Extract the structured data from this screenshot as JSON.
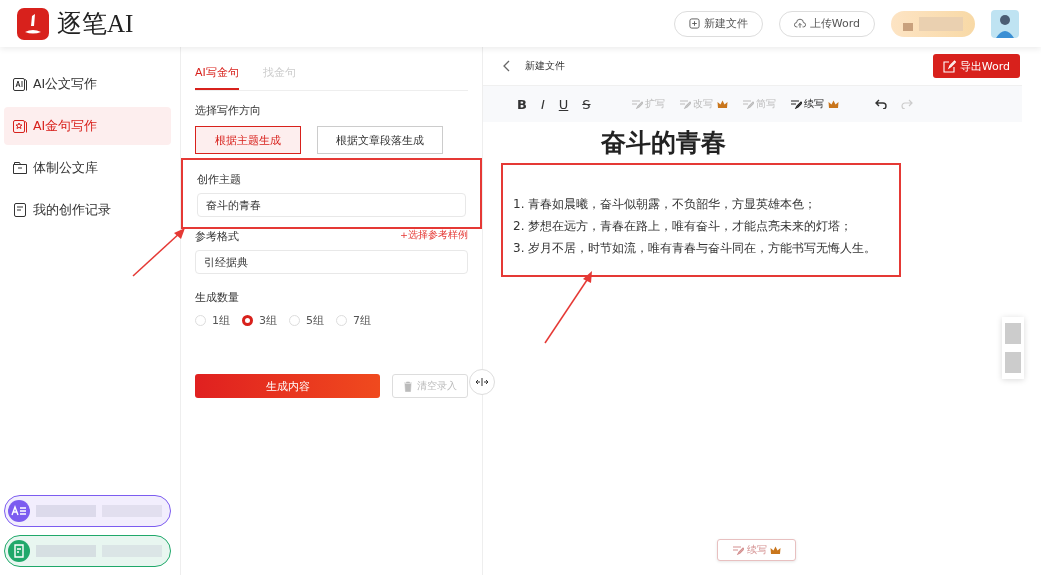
{
  "header": {
    "logo_text": "逐笔AI",
    "buttons": [
      {
        "label": "新建文件",
        "kind": "new"
      },
      {
        "label": "上传Word",
        "kind": "upload"
      }
    ]
  },
  "sidebar": {
    "items": [
      {
        "label": "AI公文写作",
        "kind": "ai-doc",
        "selected": false
      },
      {
        "label": "AI金句写作",
        "kind": "ai-quote",
        "selected": true
      },
      {
        "label": "体制公文库",
        "kind": "library",
        "selected": false
      },
      {
        "label": "我的创作记录",
        "kind": "history",
        "selected": false
      }
    ],
    "promos": [
      {
        "kind": "text-tool",
        "color": "#7c5cf0"
      },
      {
        "kind": "note-tool",
        "color": "#1fa86a"
      }
    ]
  },
  "form": {
    "tabs": [
      {
        "label": "AI写金句",
        "selected": true
      },
      {
        "label": "找金句",
        "selected": false
      }
    ],
    "direction_label": "选择写作方向",
    "directions": [
      {
        "label": "根据主题生成",
        "selected": true
      },
      {
        "label": "根据文章段落生成",
        "selected": false
      }
    ],
    "topic": {
      "label": "创作主题",
      "value": "奋斗的青春",
      "highlighted": true
    },
    "format": {
      "label": "参考格式",
      "link": "+选择参考样例",
      "value": "引经据典"
    },
    "count_label": "生成数量",
    "counts": [
      {
        "label": "1组",
        "selected": false
      },
      {
        "label": "3组",
        "selected": true
      },
      {
        "label": "5组",
        "selected": false
      },
      {
        "label": "7组",
        "selected": false
      }
    ],
    "generate_button": "生成内容",
    "clear_button": {
      "label": "清空录入",
      "disabled": true
    }
  },
  "editor": {
    "title": "新建文件",
    "export_button": "导出Word",
    "format_buttons": [
      {
        "label": "B",
        "kind": "bold"
      },
      {
        "label": "I",
        "kind": "italic"
      },
      {
        "label": "U",
        "kind": "underline"
      },
      {
        "label": "S",
        "kind": "strike"
      }
    ],
    "tools": [
      {
        "label": "扩写",
        "disabled": true,
        "premium": false
      },
      {
        "label": "改写",
        "disabled": true,
        "premium": true
      },
      {
        "label": "简写",
        "disabled": true,
        "premium": false
      },
      {
        "label": "续写",
        "disabled": false,
        "premium": true
      }
    ],
    "history": [
      {
        "kind": "undo",
        "disabled": false
      },
      {
        "kind": "redo",
        "disabled": true
      }
    ],
    "doc_title": "奋斗的青春",
    "content_highlighted": true,
    "lines": [
      "1. 青春如晨曦，奋斗似朝露，不负韶华，方显英雄本色；",
      "2. 梦想在远方，青春在路上，唯有奋斗，才能点亮未来的灯塔；",
      "3. 岁月不居，时节如流，唯有青春与奋斗同在，方能书写无悔人生。"
    ],
    "float_button": {
      "label": "续写",
      "premium": true
    }
  }
}
